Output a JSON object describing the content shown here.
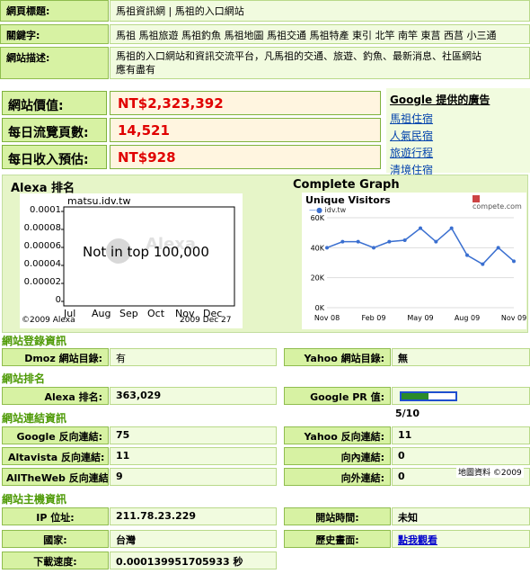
{
  "meta": {
    "title_label": "網頁標題:",
    "title_value": "馬祖資訊網 | 馬祖的入口網站",
    "keywords_label": "關鍵字:",
    "keywords_value": "馬祖 馬祖旅遊 馬祖釣魚 馬祖地圖 馬祖交通 馬祖特產 東引 北竿 南竿 東莒 西莒 小三通",
    "desc_label": "網站描述:",
    "desc_value_line1": "馬祖的入口網站和資訊交流平台，凡馬祖的交通、旅遊、釣魚、最新消息、社區網站",
    "desc_value_line2": "應有盡有"
  },
  "stats": {
    "value_label": "網站價值:",
    "value_amount": "NT$2,323,392",
    "views_label": "每日流覽頁數:",
    "views_amount": "14,521",
    "income_label": "每日收入預估:",
    "income_amount": "NT$928"
  },
  "ads": {
    "heading": "Google 提供的廣告",
    "links": [
      "馬祖住宿",
      "人氣民宿",
      "旅遊行程",
      "清境住宿"
    ]
  },
  "alexa_chart": {
    "heading": "Alexa 排名",
    "domain": "matsu.idv.tw",
    "yticks": [
      "0.0001",
      "0.00008",
      "0.00006",
      "0.00004",
      "0.00002",
      "0"
    ],
    "xticks": [
      "Jul",
      "Aug",
      "Sep",
      "Oct",
      "Nov",
      "Dec"
    ],
    "overlay": "Not in top 100,000",
    "copyright": "©2009 Alexa",
    "date": "2009 Dec 27"
  },
  "complete_chart": {
    "heading": "Complete Graph",
    "title": "Unique Visitors",
    "brand": "compete.com",
    "legend": "idv.tw",
    "yticks": [
      "60K",
      "40K",
      "20K",
      "0K"
    ],
    "xticks": [
      "Nov 08",
      "Feb 09",
      "May 09",
      "Aug 09",
      "Nov 09"
    ],
    "chart_data": {
      "type": "line",
      "title": "Unique Visitors",
      "series": [
        {
          "name": "idv.tw",
          "values": [
            40000,
            44000,
            44000,
            40000,
            44000,
            45000,
            53000,
            44000,
            53000,
            35000,
            29000,
            40000,
            31000
          ]
        }
      ],
      "ylim": [
        0,
        60000
      ]
    }
  },
  "login": {
    "section": "網站登錄資訊",
    "dmoz_label": "Dmoz 網站目錄:",
    "dmoz_value": "有",
    "yahoo_label": "Yahoo 網站目錄:",
    "yahoo_value": "無"
  },
  "rank": {
    "section": "網站排名",
    "alexa_label": "Alexa 排名:",
    "alexa_value": "363,029",
    "pr_label": "Google PR 值:",
    "pr_value": "5/10",
    "pr_fraction": 0.5
  },
  "links": {
    "section": "網站連結資訊",
    "google_label": "Google 反向連結:",
    "google_value": "75",
    "yahoo_label": "Yahoo 反向連結:",
    "yahoo_value": "11",
    "altavista_label": "Altavista 反向連結:",
    "altavista_value": "11",
    "inbound_label": "向內連結:",
    "inbound_value": "0",
    "alltheweb_label": "AllTheWeb 反向連結:",
    "alltheweb_value": "9",
    "outbound_label": "向外連結:",
    "outbound_value": "0",
    "map_note": "地圖資料 ©2009"
  },
  "host": {
    "section": "網站主機資訊",
    "ip_label": "IP 位址:",
    "ip_value": "211.78.23.229",
    "open_label": "開站時間:",
    "open_value": "未知",
    "country_label": "國家:",
    "country_value": "台灣",
    "history_label": "歷史畫面:",
    "history_value": "點我觀看",
    "speed_label": "下載速度:",
    "speed_value": "0.000139951705933 秒"
  }
}
